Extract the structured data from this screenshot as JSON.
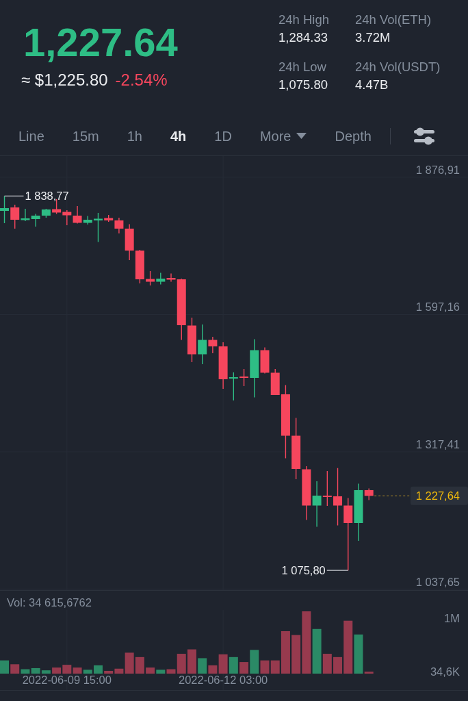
{
  "ticker": {
    "last_price": {
      "value": "1,227.64",
      "up": true
    },
    "fiat_price": "≈ $1,225.80",
    "change": {
      "value": "-2.54%",
      "up": false
    }
  },
  "stats": [
    {
      "label": "24h High",
      "value": "1,284.33"
    },
    {
      "label": "24h Vol(ETH)",
      "value": "3.72M"
    },
    {
      "label": "24h Low",
      "value": "1,075.80"
    },
    {
      "label": "24h Vol(USDT)",
      "value": "4.47B"
    }
  ],
  "intervals": [
    {
      "label": "Line",
      "kind": "tab",
      "selected": false
    },
    {
      "label": "15m",
      "kind": "tab",
      "selected": false
    },
    {
      "label": "1h",
      "kind": "tab",
      "selected": false
    },
    {
      "label": "4h",
      "kind": "tab",
      "selected": true
    },
    {
      "label": "1D",
      "kind": "tab",
      "selected": false
    },
    {
      "label": "More",
      "kind": "dropdown",
      "selected": false
    },
    {
      "label": "Depth",
      "kind": "tab",
      "selected": false
    }
  ],
  "price_chart": {
    "high_label": "1 838,77",
    "low_label": "1 075,80",
    "last_price_label": "1 227,64",
    "chart_data": {
      "type": "candlestick",
      "categories": [
        null,
        null,
        null,
        null,
        null,
        null,
        null,
        null,
        null,
        null,
        null,
        null,
        null,
        null,
        null,
        null,
        null,
        null,
        null,
        null,
        null,
        null,
        null,
        null,
        null,
        null,
        null,
        null,
        null,
        null,
        null,
        null,
        null,
        null,
        null,
        null
      ],
      "ohlc": [
        [
          1808.5,
          1838.77,
          1783.4,
          1814.1
        ],
        [
          1815.5,
          1821.1,
          1772.3,
          1790.4
        ],
        [
          1789.7,
          1812.7,
          1787.6,
          1793.2
        ],
        [
          1791.8,
          1802.3,
          1776.5,
          1798.8
        ],
        [
          1798.8,
          1812.7,
          1794.6,
          1811.3
        ],
        [
          1812.0,
          1832.3,
          1802.3,
          1805.1
        ],
        [
          1806.4,
          1809.9,
          1779.2,
          1799.5
        ],
        [
          1798.8,
          1818.3,
          1782.7,
          1784.1
        ],
        [
          1784.1,
          1798.1,
          1780.6,
          1790.4
        ],
        [
          1789.0,
          1804.4,
          1745.1,
          1792.5
        ],
        [
          1793.9,
          1800.2,
          1786.2,
          1789.0
        ],
        [
          1789.0,
          1794.6,
          1762.5,
          1772.3
        ],
        [
          1772.3,
          1781.3,
          1708.1,
          1727.6
        ],
        [
          1727.6,
          1729.0,
          1660.6,
          1669.0
        ],
        [
          1669.7,
          1685.8,
          1656.5,
          1664.1
        ],
        [
          1664.1,
          1682.3,
          1658.6,
          1670.4
        ],
        [
          1671.8,
          1680.9,
          1664.1,
          1668.3
        ],
        [
          1669.0,
          1670.4,
          1545.5,
          1575.5
        ],
        [
          1574.8,
          1590.9,
          1500.2,
          1516.2
        ],
        [
          1516.2,
          1576.9,
          1496.0,
          1545.5
        ],
        [
          1545.5,
          1551.8,
          1518.3,
          1532.3
        ],
        [
          1532.3,
          1540.7,
          1445.8,
          1465.3
        ],
        [
          1466.7,
          1479.3,
          1422.1,
          1469.5
        ],
        [
          1470.9,
          1486.2,
          1451.4,
          1468.1
        ],
        [
          1468.1,
          1546.9,
          1428.3,
          1524.6
        ],
        [
          1524.6,
          1530.2,
          1477.2,
          1478.6
        ],
        [
          1478.6,
          1486.2,
          1433.2,
          1433.2
        ],
        [
          1434.6,
          1453.4,
          1304.2,
          1350.2
        ],
        [
          1350.2,
          1386.5,
          1261.6,
          1282.5
        ],
        [
          1281.8,
          1288.1,
          1178.6,
          1207.9
        ],
        [
          1207.9,
          1257.4,
          1164.6,
          1228.1
        ],
        [
          1228.1,
          1278.3,
          1207.2,
          1225.3
        ],
        [
          1226.7,
          1284.3,
          1167.4,
          1207.9
        ],
        [
          1207.9,
          1223.2,
          1075.8,
          1172.3
        ],
        [
          1172.3,
          1252.5,
          1136.0,
          1239.3
        ],
        [
          1239.3,
          1242.8,
          1219.0,
          1227.64
        ]
      ],
      "ylim": [
        1035.56,
        1920.16
      ],
      "yticks": [
        {
          "value": 1876.91,
          "label": "1 876,91"
        },
        {
          "value": 1597.16,
          "label": "1 597,16"
        },
        {
          "value": 1317.41,
          "label": "1 317,41"
        },
        {
          "value": 1037.65,
          "label": "1 037,65"
        }
      ]
    }
  },
  "volume": {
    "label": "Vol: 34 615,6762",
    "chart_data": {
      "type": "bar",
      "stacked": true,
      "categories": [
        null,
        null,
        null,
        null,
        null,
        null,
        "2022-06-09 15:00",
        null,
        null,
        null,
        null,
        null,
        null,
        null,
        null,
        null,
        null,
        null,
        null,
        null,
        null,
        "2022-06-12 03:00",
        null,
        null,
        null,
        null,
        null,
        null,
        null,
        null,
        null,
        null,
        null,
        null,
        null,
        null
      ],
      "series": [
        {
          "color": "#2b8a66",
          "values": [
            240000,
            null,
            80000,
            100000,
            60000,
            null,
            null,
            null,
            70000,
            150000,
            null,
            null,
            null,
            null,
            null,
            70000,
            null,
            null,
            null,
            280000,
            null,
            null,
            300000,
            null,
            430000,
            null,
            null,
            null,
            null,
            null,
            810000,
            null,
            null,
            null,
            710000,
            null
          ]
        },
        {
          "color": "#973a4e",
          "values": [
            null,
            170000,
            null,
            null,
            null,
            110000,
            160000,
            110000,
            null,
            null,
            50000,
            90000,
            380000,
            300000,
            110000,
            null,
            80000,
            360000,
            440000,
            null,
            150000,
            350000,
            null,
            210000,
            null,
            240000,
            240000,
            770000,
            700000,
            1130000,
            null,
            360000,
            300000,
            960000,
            null,
            35000
          ]
        }
      ],
      "ylim": [
        0,
        1155000
      ],
      "yticks": [
        {
          "value": 34616,
          "label": "34,6K"
        },
        {
          "value": 1000000,
          "label": "1M"
        }
      ]
    }
  }
}
